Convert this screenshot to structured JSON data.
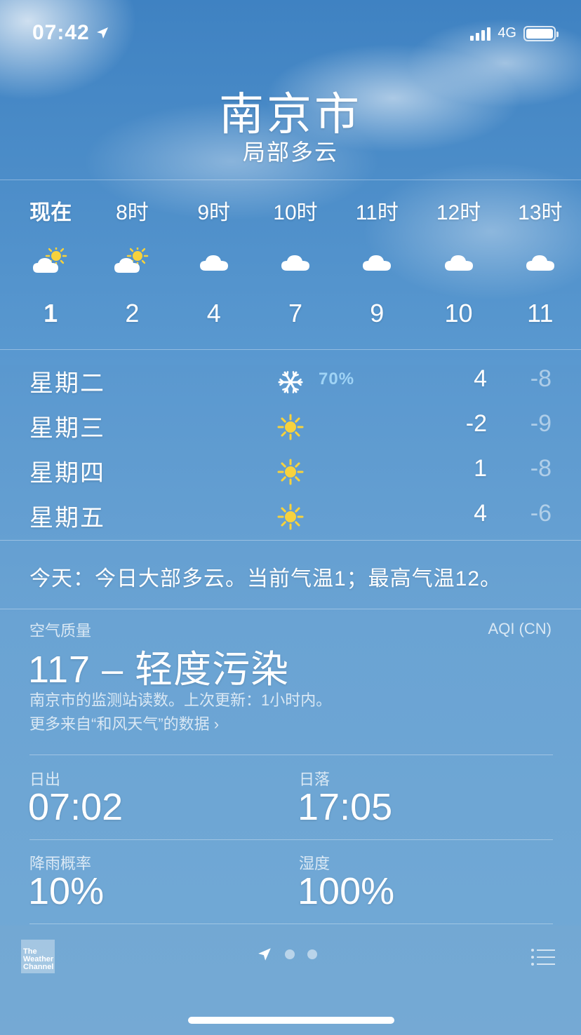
{
  "status_bar": {
    "time": "07:42",
    "network": "4G"
  },
  "header": {
    "city": "南京市",
    "condition": "局部多云"
  },
  "hourly": [
    {
      "label": "现在",
      "icon": "partly-sunny-icon",
      "temp": "1",
      "now": true
    },
    {
      "label": "8时",
      "icon": "partly-sunny-icon",
      "temp": "2"
    },
    {
      "label": "9时",
      "icon": "cloud-icon",
      "temp": "4"
    },
    {
      "label": "10时",
      "icon": "cloud-icon",
      "temp": "7"
    },
    {
      "label": "11时",
      "icon": "cloud-icon",
      "temp": "9"
    },
    {
      "label": "12时",
      "icon": "cloud-icon",
      "temp": "10"
    },
    {
      "label": "13时",
      "icon": "cloud-icon",
      "temp": "11"
    }
  ],
  "daily": [
    {
      "day": "星期二",
      "icon": "snowflake-icon",
      "precip": "70%",
      "high": "4",
      "low": "-8"
    },
    {
      "day": "星期三",
      "icon": "sun-icon",
      "precip": "",
      "high": "-2",
      "low": "-9"
    },
    {
      "day": "星期四",
      "icon": "sun-icon",
      "precip": "",
      "high": "1",
      "low": "-8"
    },
    {
      "day": "星期五",
      "icon": "sun-icon",
      "precip": "",
      "high": "4",
      "low": "-6"
    }
  ],
  "summary": "今天：今日大部多云。当前气温1；最高气温12。",
  "air_quality": {
    "label": "空气质量",
    "index_name": "AQI (CN)",
    "value": "117 – 轻度污染",
    "note": "南京市的监测站读数。上次更新：1小时内。",
    "link": "更多来自“和风天气”的数据"
  },
  "details": {
    "sunrise_label": "日出",
    "sunrise": "07:02",
    "sunset_label": "日落",
    "sunset": "17:05",
    "rain_label": "降雨概率",
    "rain": "10%",
    "humidity_label": "湿度",
    "humidity": "100%"
  },
  "footer": {
    "provider": "The Weather Channel"
  },
  "colors": {
    "sky_top": "#3f82c2",
    "precip": "#9fd3f5",
    "sun": "#f7d23c"
  }
}
